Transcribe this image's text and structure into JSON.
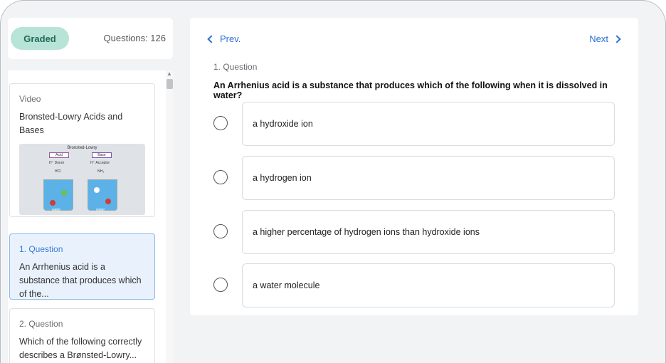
{
  "header": {
    "graded_label": "Graded",
    "questions_count": "Questions: 126"
  },
  "sidebar": {
    "items": [
      {
        "kind": "Video",
        "title": "Bronsted-Lowry Acids and Bases",
        "thumbnail": {
          "caption": "Bronsted-Lowry",
          "left_label": "Acid",
          "left_sub": "H⁺ Donor",
          "left_formula": "HCl",
          "right_label": "Base",
          "right_sub": "H⁺ Acceptor",
          "right_formula": "NH₃",
          "water": "water"
        }
      },
      {
        "kind": "1. Question",
        "title": "An Arrhenius acid is a substance that produces which of the...",
        "active": true
      },
      {
        "kind": "2. Question",
        "title": "Which of the following correctly describes a Brønsted-Lowry..."
      }
    ]
  },
  "main": {
    "prev_label": "Prev.",
    "next_label": "Next",
    "question_label": "1. Question",
    "question_text": "An Arrhenius acid is a substance that produces which of the following when it is dissolved in water?",
    "options": [
      "a hydroxide ion",
      "a hydrogen ion",
      "a higher percentage of hydrogen ions than hydroxide ions",
      "a water molecule"
    ]
  },
  "colors": {
    "accent": "#2d6fd6",
    "graded_bg": "#b8e3d7",
    "active_card_bg": "#e9f2fc"
  }
}
